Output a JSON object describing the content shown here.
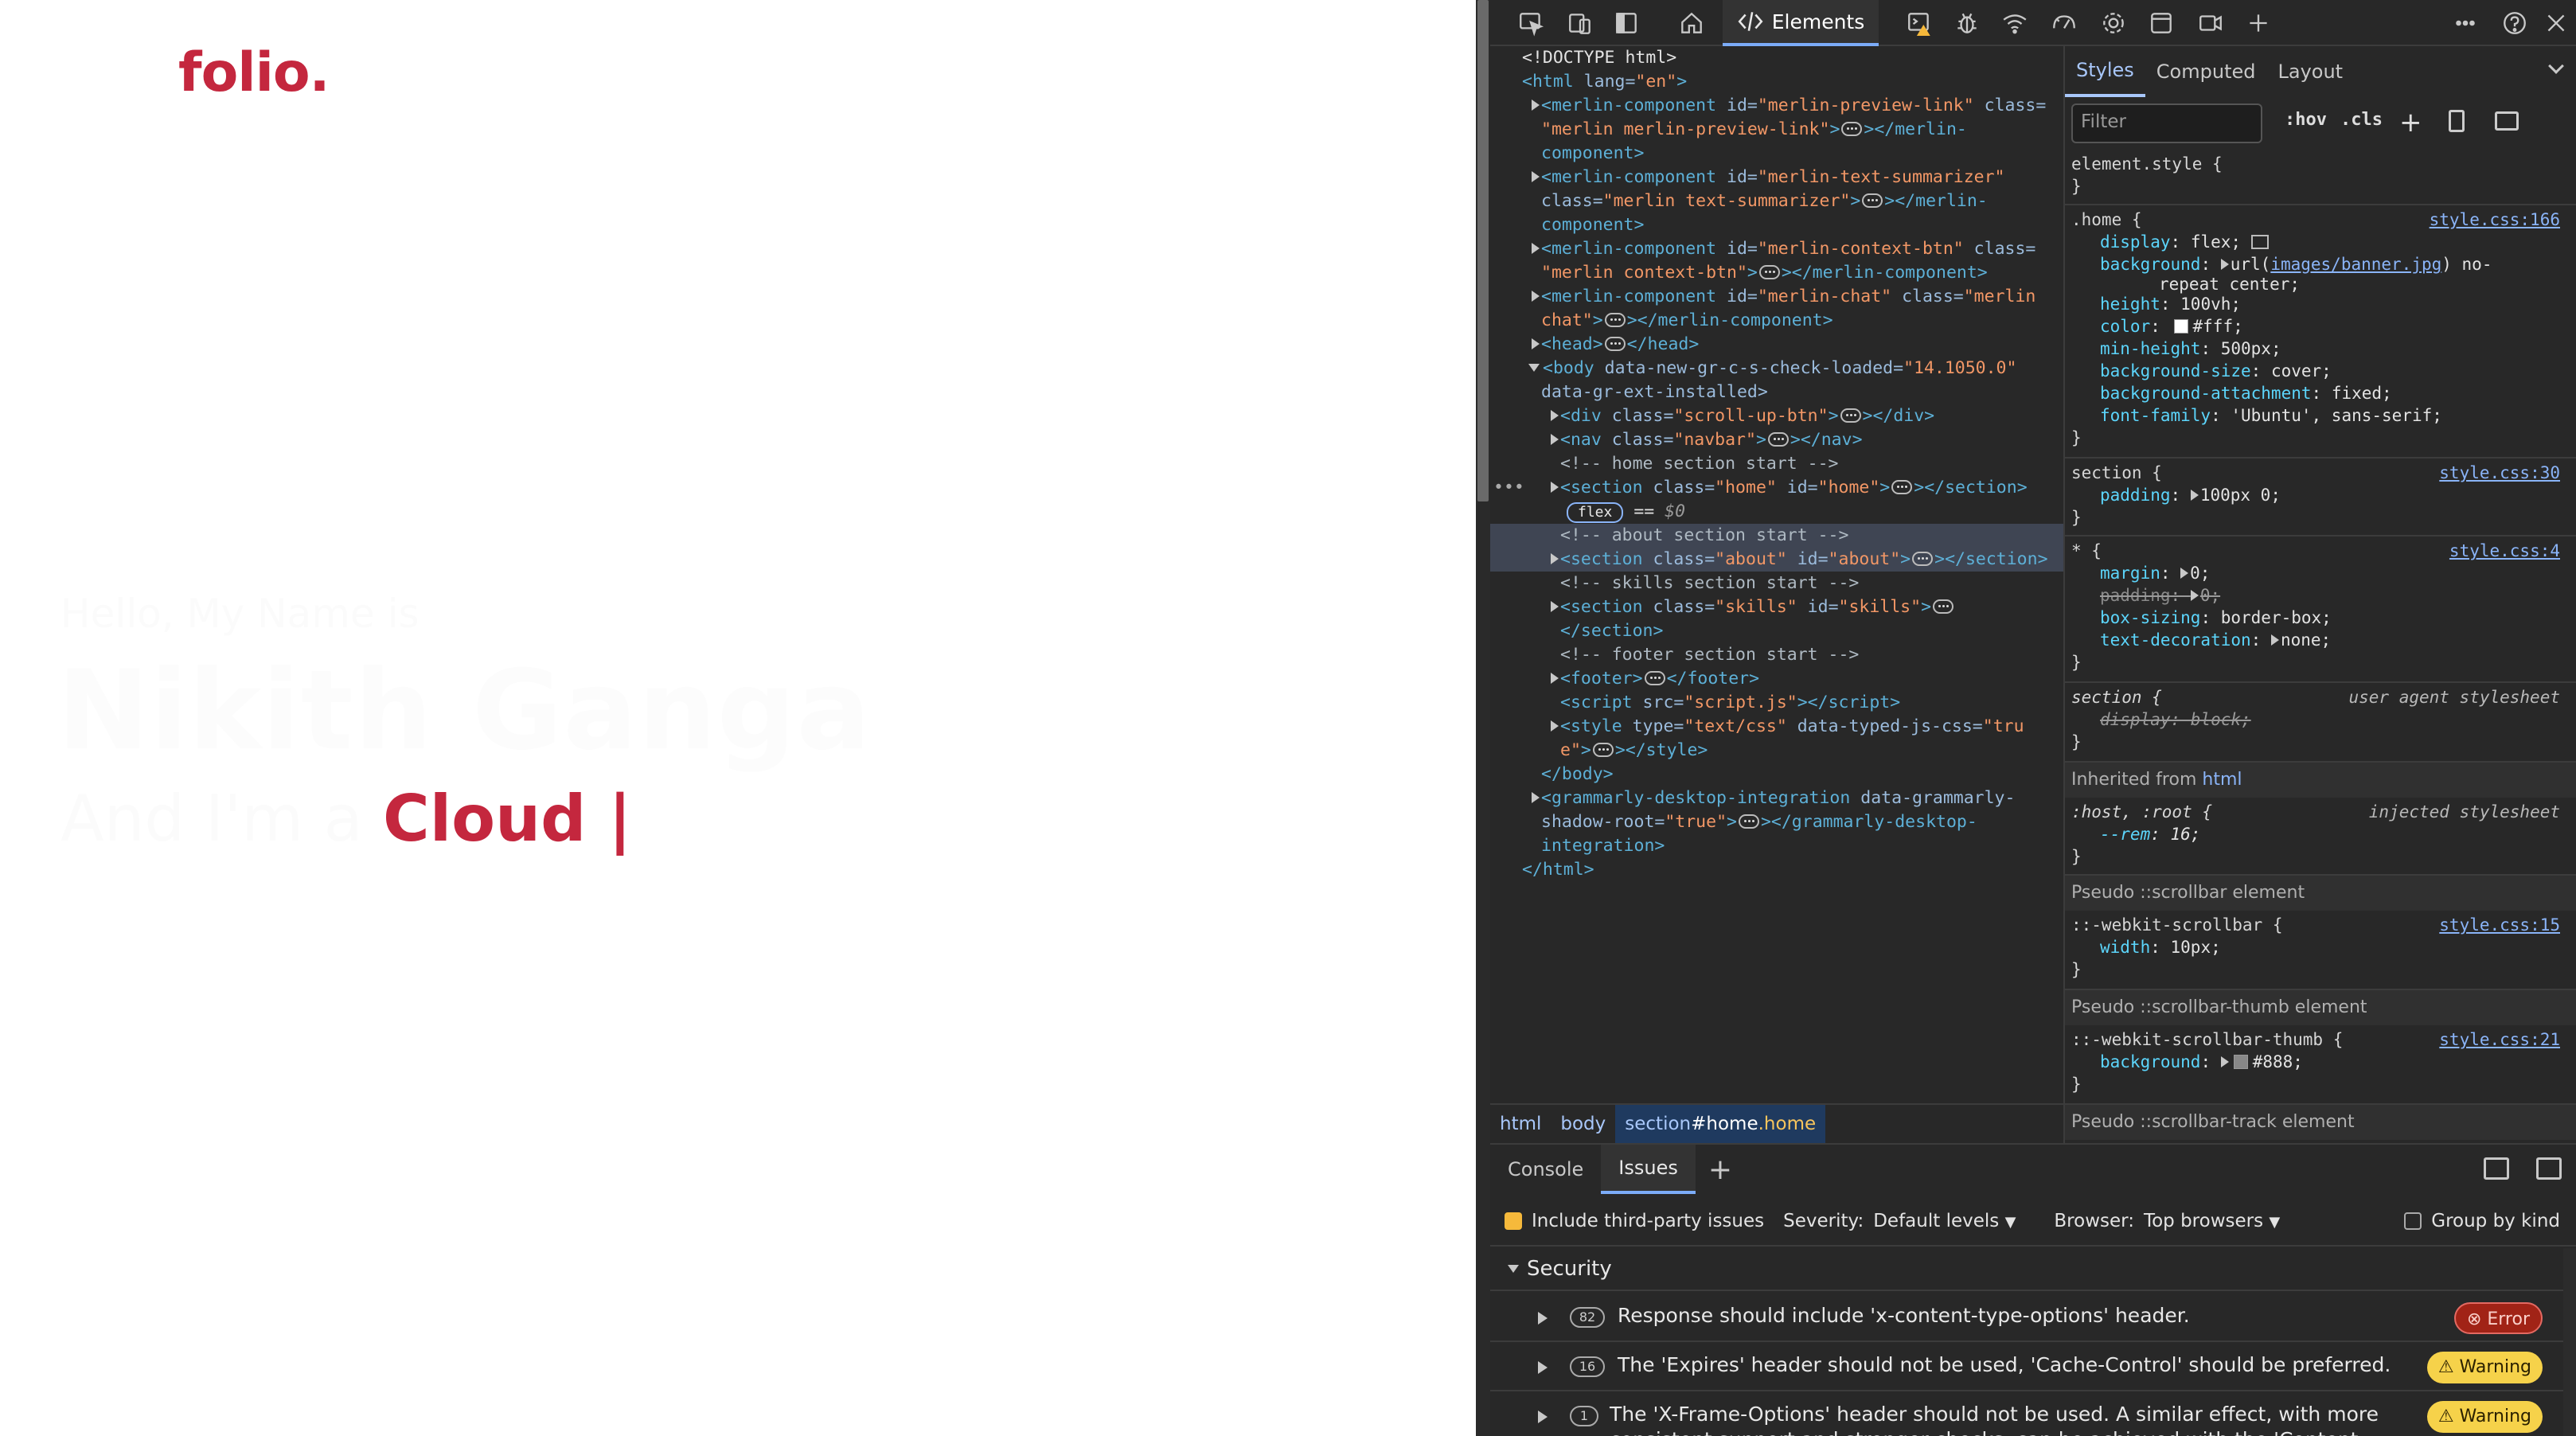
{
  "preview": {
    "logo": "folio.",
    "hello": "Hello, My Name is",
    "name": "Nikith Ganga",
    "role_prefix": "And I'm a ",
    "role_typed": "Cloud |"
  },
  "devtools": {
    "top_tab": "Elements",
    "dom": {
      "l1": "<!DOCTYPE html>",
      "l2_tag": "<html",
      "l2_an": " lang=",
      "l2_av": "\"en\"",
      "l2_end": ">",
      "l3a": "<merlin-component",
      "l3b": " id=",
      "l3c": "\"merlin-preview-link\"",
      "l3d": " class=",
      "l4a": "\"merlin merlin-preview-link\"",
      "l4b": "></merlin-",
      "l5": "component>",
      "l6a": "<merlin-component",
      "l6b": " id=",
      "l6c": "\"merlin-text-summarizer\"",
      "l7a": "class=",
      "l7b": "\"merlin text-summarizer\"",
      "l7c": "></merlin-",
      "l8": "component>",
      "l9a": "<merlin-component",
      "l9b": " id=",
      "l9c": "\"merlin-context-btn\"",
      "l9d": " class=",
      "l10a": "\"merlin context-btn\"",
      "l10b": "></merlin-component>",
      "l11a": "<merlin-component",
      "l11b": " id=",
      "l11c": "\"merlin-chat\"",
      "l11d": " class=",
      "l11e": "\"merlin",
      "l12a": "chat\"",
      "l12b": "></merlin-component>",
      "l13a": "<head>",
      "l13b": "</head>",
      "l14a": "<body",
      "l14b": " data-new-gr-c-s-check-loaded=",
      "l14c": "\"14.1050.0\"",
      "l15": "data-gr-ext-installed>",
      "l16a": "<div",
      "l16b": " class=",
      "l16c": "\"scroll-up-btn\"",
      "l16d": "></div>",
      "l17a": "<nav",
      "l17b": " class=",
      "l17c": "\"navbar\"",
      "l17d": "></nav>",
      "l18": "<!-- home section start -->",
      "l19a": "<section",
      "l19b": " class=",
      "l19c": "\"home\"",
      "l19d": " id=",
      "l19e": "\"home\"",
      "l19f": "></section>",
      "flex": "flex",
      "eq": "==",
      "dollar": "$0",
      "l21": "<!-- about section start -->",
      "l22a": "<section",
      "l22b": " class=",
      "l22c": "\"about\"",
      "l22d": " id=",
      "l22e": "\"about\"",
      "l22f": "></section>",
      "l23": "<!-- skills section start -->",
      "l24a": "<section",
      "l24b": " class=",
      "l24c": "\"skills\"",
      "l24d": " id=",
      "l24e": "\"skills\"",
      "l24f": ">",
      "l25": "</section>",
      "l26": "<!-- footer section start -->",
      "l27a": "<footer>",
      "l27b": "</footer>",
      "l28a": "<script",
      "l28b": " src=",
      "l28c": "\"script.js\"",
      "l28d": "></scr",
      "l28e": "ipt>",
      "l29a": "<style",
      "l29b": " type=",
      "l29c": "\"text/css\"",
      "l29d": " data-typed-js-css=",
      "l29e": "\"tru",
      "l30a": "e\"",
      "l30b": "></style>",
      "l31": "</body>",
      "l32a": "<grammarly-desktop-integration",
      "l32b": " data-grammarly-",
      "l33a": "shadow-root=",
      "l33b": "\"true\"",
      "l33c": "></grammarly-desktop-",
      "l34": "integration>",
      "l35": "</html>"
    },
    "breadcrumbs": {
      "c1": "html",
      "c2": "body",
      "c3_tag": "section",
      "c3_id": "#home",
      "c3_cls": ".home"
    },
    "styles": {
      "tabs": [
        "Styles",
        "Computed",
        "Layout"
      ],
      "filter_placeholder": "Filter",
      "hov": ":hov",
      "cls": ".cls",
      "r0_sel": "element.style {",
      "close": "}",
      "r1_sel": ".home {",
      "r1_src": "style.css:166",
      "r1_d1n": "display",
      "r1_d1v": "flex;",
      "r1_d2n": "background",
      "r1_d2v_a": "url(",
      "r1_d2v_link": "images/banner.jpg",
      "r1_d2v_b": ") no-",
      "r1_d2v_c": "repeat center;",
      "r1_d3n": "height",
      "r1_d3v": "100vh;",
      "r1_d4n": "color",
      "r1_d4v": "#fff;",
      "r1_d5n": "min-height",
      "r1_d5v": "500px;",
      "r1_d6n": "background-size",
      "r1_d6v": "cover;",
      "r1_d7n": "background-attachment",
      "r1_d7v": "fixed;",
      "r1_d8n": "font-family",
      "r1_d8v": "'Ubuntu', sans-serif;",
      "r2_sel": "section {",
      "r2_src": "style.css:30",
      "r2_d1n": "padding",
      "r2_d1v": "100px 0;",
      "r3_sel": "* {",
      "r3_src": "style.css:4",
      "r3_d1n": "margin",
      "r3_d1v": "0;",
      "r3_d2n": "padding",
      "r3_d2v": "0;",
      "r3_d3n": "box-sizing",
      "r3_d3v": "border-box;",
      "r3_d4n": "text-decoration",
      "r3_d4v": "none;",
      "r4_sel": "section {",
      "r4_src": "user agent stylesheet",
      "r4_d1": "display: block;",
      "inherited_label": "Inherited from ",
      "inherited_tag": "html",
      "r5_sel": ":host, :root {",
      "r5_src": "injected stylesheet",
      "r5_d1n": "--rem",
      "r5_d1v": "16;",
      "p1": "Pseudo ::scrollbar element",
      "r6_sel": "::-webkit-scrollbar {",
      "r6_src": "style.css:15",
      "r6_d1n": "width",
      "r6_d1v": "10px;",
      "p2": "Pseudo ::scrollbar-thumb element",
      "r7_sel": "::-webkit-scrollbar-thumb {",
      "r7_src": "style.css:21",
      "r7_d1n": "background",
      "r7_d1v": "#888;",
      "p3": "Pseudo ::scrollbar-track element"
    },
    "drawer": {
      "tabs": [
        "Console",
        "Issues"
      ],
      "include_third_party": "Include third-party issues",
      "severity_label": "Severity:",
      "severity_value": "Default levels",
      "browser_label": "Browser:",
      "browser_value": "Top browsers",
      "group_by_kind": "Group by kind",
      "section": "Security",
      "issues": [
        {
          "count": "82",
          "message": "Response should include 'x-content-type-options' header.",
          "badge": "Error"
        },
        {
          "count": "16",
          "message": "The 'Expires' header should not be used, 'Cache-Control' should be preferred.",
          "badge": "Warning"
        },
        {
          "count": "1",
          "message": "The 'X-Frame-Options' header should not be used. A similar effect, with more",
          "badge": "Warning"
        }
      ],
      "issue3_line2": "consistent support and stronger checks, can be achieved with the 'Content-"
    },
    "colors": {
      "accent": "#c4273e",
      "selection": "#3f4553",
      "link": "#8ab4f8",
      "warning": "#f6d24a",
      "error": "#a12316"
    }
  }
}
